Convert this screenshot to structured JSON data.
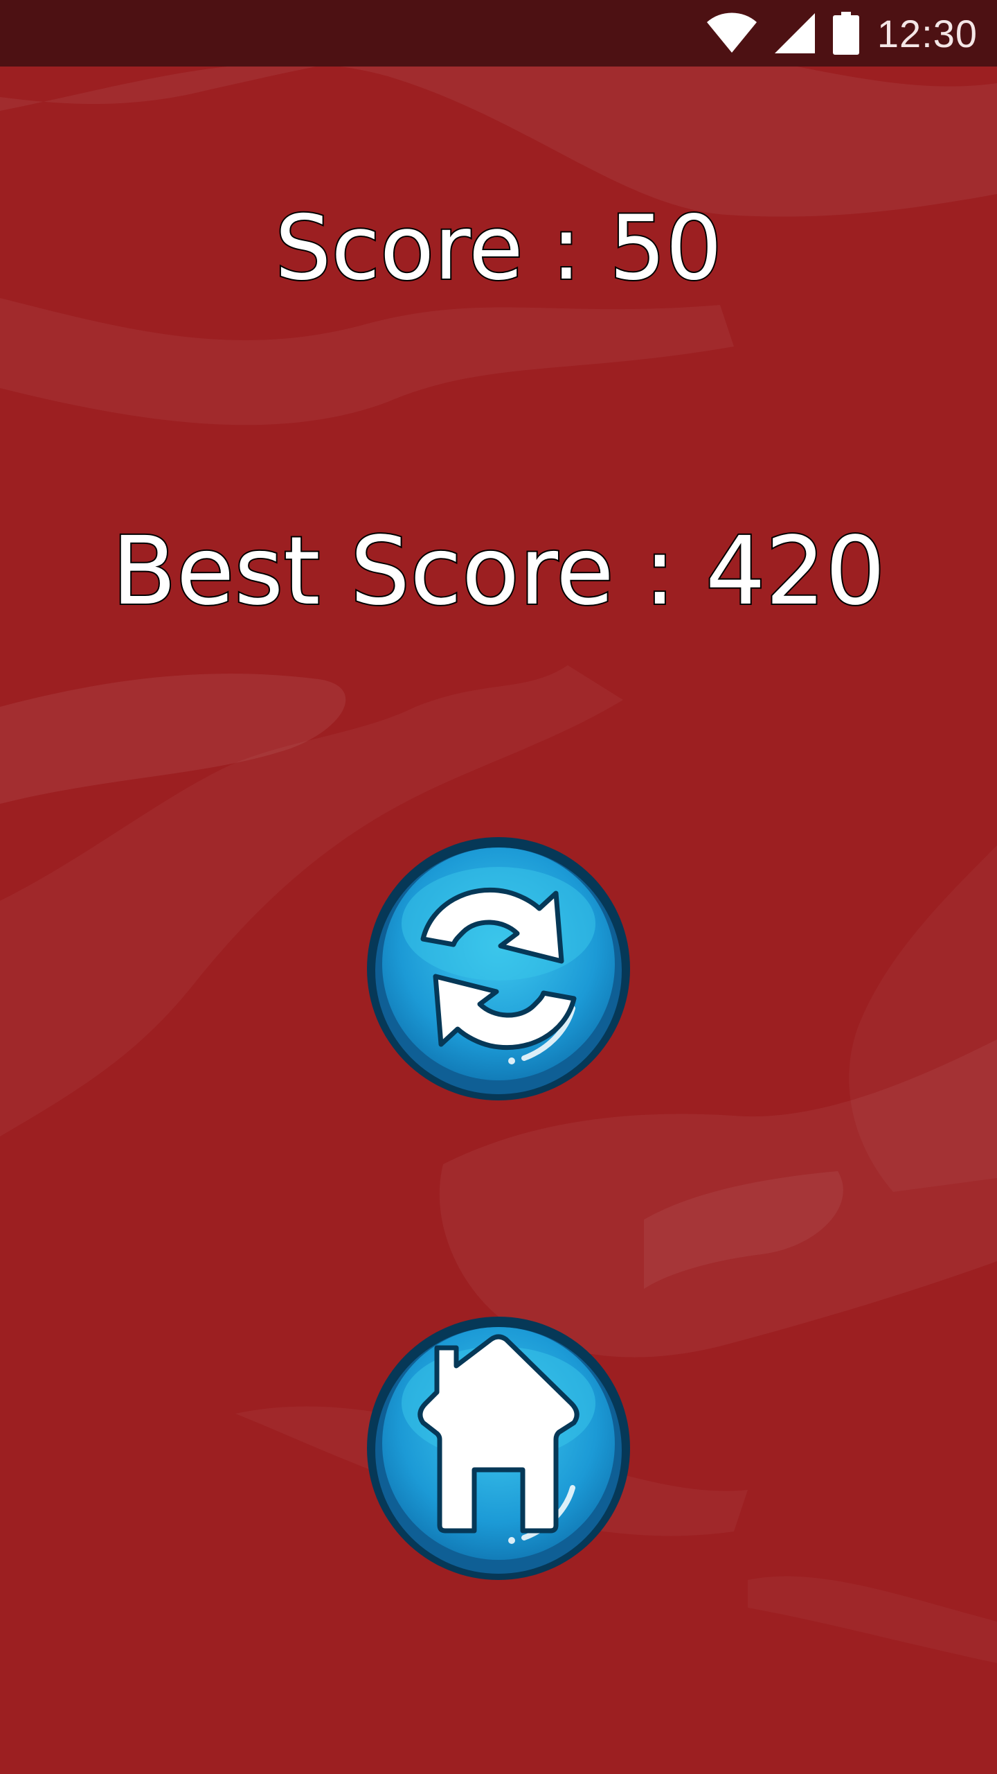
{
  "status_bar": {
    "time": "12:30",
    "icons": [
      "wifi-icon",
      "cellular-signal-icon",
      "battery-icon"
    ]
  },
  "scores": {
    "current_label": "Score : 50",
    "best_label": "Best Score : 420"
  },
  "buttons": {
    "restart_icon": "refresh-icon",
    "home_icon": "home-icon"
  },
  "colors": {
    "background": "#9c1f21",
    "status_bar": "#4d1113",
    "button_blue": "#1f9bd8",
    "button_rim": "#0a4d7a"
  }
}
